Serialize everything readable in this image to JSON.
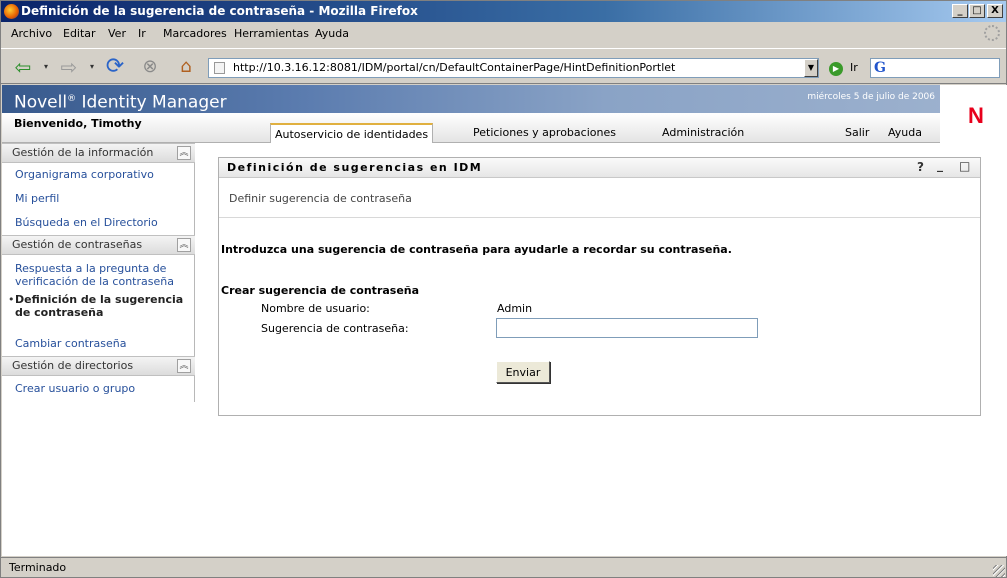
{
  "window": {
    "title": "Definición de la sugerencia de contraseña - Mozilla Firefox",
    "controls": [
      "_",
      "□",
      "X"
    ]
  },
  "menubar": [
    "Archivo",
    "Editar",
    "Ver",
    "Ir",
    "Marcadores",
    "Herramientas",
    "Ayuda"
  ],
  "navbar": {
    "url": "http://10.3.16.12:8081/IDM/portal/cn/DefaultContainerPage/HintDefinitionPortlet",
    "go_label": "Ir",
    "icons": [
      "back-icon",
      "forward-icon",
      "reload-icon",
      "stop-icon",
      "home-icon"
    ]
  },
  "header": {
    "app_title": "Novell",
    "app_title_reg": "®",
    "app_title_rest": " Identity Manager",
    "date": "miércoles 5 de julio de 2006",
    "logo": "N",
    "welcome": "Bienvenido, Timothy",
    "tabs": [
      "Autoservicio de identidades",
      "Peticiones y aprobaciones",
      "Administración"
    ],
    "links": [
      "Salir",
      "Ayuda"
    ]
  },
  "sidebar": {
    "sections": [
      {
        "title": "Gestión de la información",
        "items": [
          "Organigrama corporativo",
          "Mi perfil",
          "Búsqueda en el Directorio"
        ]
      },
      {
        "title": "Gestión de contraseñas",
        "items": [
          "Respuesta a la pregunta de verificación de la contraseña",
          "Definición de la sugerencia de contraseña",
          "Cambiar contraseña"
        ]
      },
      {
        "title": "Gestión de directorios",
        "items": [
          "Crear usuario o grupo"
        ]
      }
    ],
    "selected_bullet": "•"
  },
  "portlet": {
    "title": "Definición de sugerencias en IDM",
    "buttons": [
      "?",
      "_",
      "□"
    ],
    "subtitle": "Definir sugerencia de contraseña",
    "intro": "Introduzca una sugerencia de contraseña para ayudarle a recordar su contraseña.",
    "form_title": "Crear sugerencia de contraseña",
    "username_label": "Nombre de usuario:",
    "username_value": "Admin",
    "hint_label": "Sugerencia de contraseña:",
    "hint_value": "",
    "submit_label": "Enviar"
  },
  "status": "Terminado"
}
